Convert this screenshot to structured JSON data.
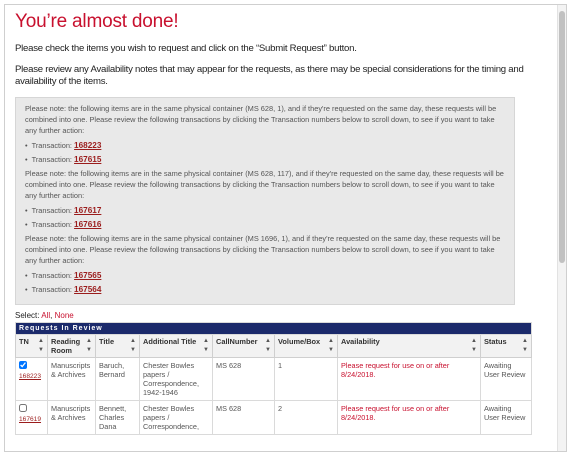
{
  "title": "You’re almost done!",
  "instructions": {
    "line1": "Please check the items you wish to request and click on the “Submit Request” button.",
    "line2": "Please review any Availability notes that may appear for the requests, as there may be special considerations for the timing and availability of the items."
  },
  "notes": [
    {
      "text": "Please note: the following items are in the same physical container (MS 628, 1), and if they're requested on the same day, these requests will be combined into one. Please review the following transactions by clicking the Transaction numbers below to scroll down, to see if you want to take any further action:",
      "transactions": [
        {
          "label": "Transaction: ",
          "number": "168223"
        },
        {
          "label": "Transaction: ",
          "number": "167615"
        }
      ]
    },
    {
      "text": "Please note: the following items are in the same physical container (MS 628, 117), and if they're requested on the same day, these requests will be combined into one. Please review the following transactions by clicking the Transaction numbers below to scroll down, to see if you want to take any further action:",
      "transactions": [
        {
          "label": "Transaction: ",
          "number": "167617"
        },
        {
          "label": "Transaction: ",
          "number": "167616"
        }
      ]
    },
    {
      "text": "Please note: the following items are in the same physical container (MS 1696, 1), and if they're requested on the same day, these requests will be combined into one. Please review the following transactions by clicking the Transaction numbers below to scroll down, to see if you want to take any further action:",
      "transactions": [
        {
          "label": "Transaction: ",
          "number": "167565"
        },
        {
          "label": "Transaction: ",
          "number": "167564"
        }
      ]
    }
  ],
  "select": {
    "label": "Select: ",
    "all": "All",
    "separator": ", ",
    "none": "None"
  },
  "table": {
    "caption": "Requests In Review",
    "headers": {
      "tn": "TN",
      "reading_room": "Reading Room",
      "title": "Title",
      "additional_title": "Additional Title",
      "call_number": "CallNumber",
      "volume_box": "Volume/Box",
      "availability": "Availability",
      "status": "Status"
    },
    "rows": [
      {
        "tn": "168223",
        "checked": true,
        "reading_room": "Manuscripts & Archives",
        "title": "Baruch, Bernard",
        "additional_title": "Chester Bowles papers / Correspondence, 1942-1946",
        "call_number": "MS 628",
        "volume_box": "1",
        "availability": "Please request for use on or after 8/24/2018.",
        "status": "Awaiting User Review"
      },
      {
        "tn": "167619",
        "checked": false,
        "reading_room": "Manuscripts & Archives",
        "title": "Bennett, Charles Dana",
        "additional_title": "Chester Bowles papers / Correspondence,",
        "call_number": "MS 628",
        "volume_box": "2",
        "availability": "Please request for use on or after 8/24/2018.",
        "status": "Awaiting User Review"
      }
    ]
  }
}
